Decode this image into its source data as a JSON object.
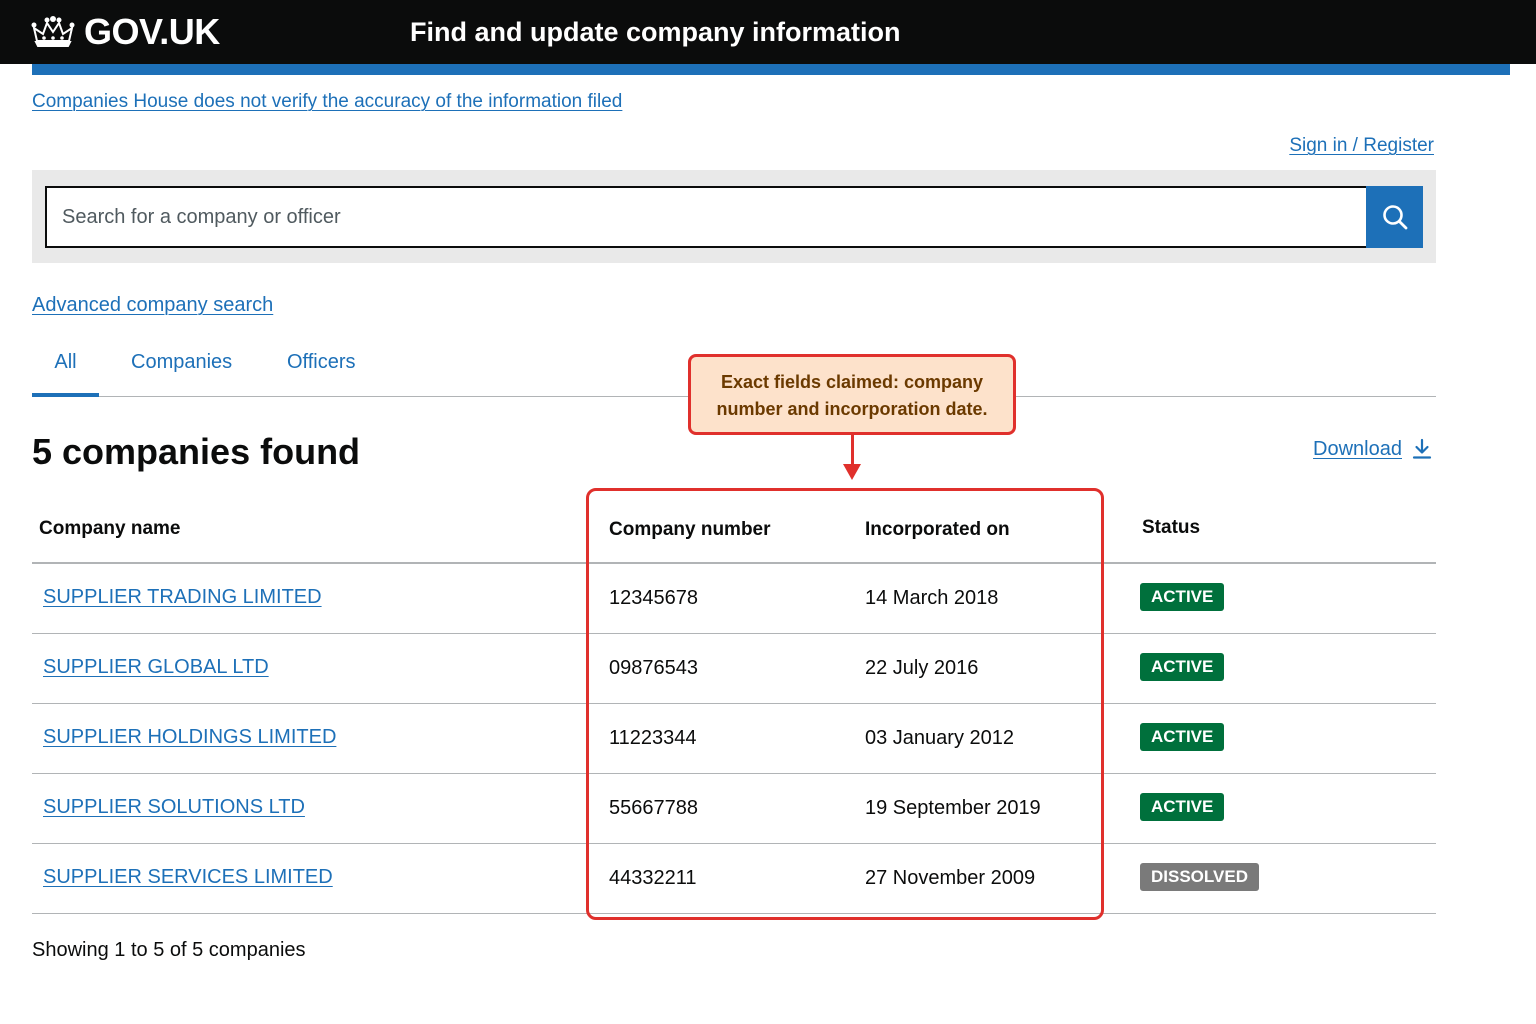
{
  "header": {
    "logo_text": "GOV.UK",
    "logo_icon": "crown-icon",
    "service_name": "Find and update company information"
  },
  "colors": {
    "header_bg": "#0b0c0c",
    "brand_blue": "#1d70b8",
    "active_green": "#00703c",
    "dissolved_grey": "#7a7a7a",
    "annotation_red": "#e0302c",
    "annotation_fill": "#fde2cb"
  },
  "disclaimer_link": "Companies House does not verify the accuracy of the information filed",
  "signin_link": "Sign in / Register",
  "search": {
    "placeholder": "Search for a company or officer",
    "value": "",
    "button_icon": "search-icon"
  },
  "advanced_search_link": "Advanced company search",
  "tabs": [
    {
      "label": "All",
      "active": true
    },
    {
      "label": "Companies",
      "active": false
    },
    {
      "label": "Officers",
      "active": false
    }
  ],
  "results": {
    "heading": "5 companies found",
    "download_label": "Download",
    "download_icon": "download-icon",
    "columns": [
      "Company name",
      "Company number",
      "Incorporated on",
      "Status"
    ],
    "rows": [
      {
        "name": "SUPPLIER TRADING LIMITED",
        "number": "12345678",
        "incorporated": "14 March 2018",
        "status": "ACTIVE"
      },
      {
        "name": "SUPPLIER GLOBAL LTD",
        "number": "09876543",
        "incorporated": "22 July 2016",
        "status": "ACTIVE"
      },
      {
        "name": "SUPPLIER HOLDINGS LIMITED",
        "number": "11223344",
        "incorporated": "03 January 2012",
        "status": "ACTIVE"
      },
      {
        "name": "SUPPLIER SOLUTIONS LTD",
        "number": "55667788",
        "incorporated": "19 September 2019",
        "status": "ACTIVE"
      },
      {
        "name": "SUPPLIER SERVICES LIMITED",
        "number": "44332211",
        "incorporated": "27 November 2009",
        "status": "DISSOLVED"
      }
    ],
    "showing_text": "Showing 1 to 5 of 5 companies"
  },
  "annotation": {
    "line1": "Exact fields claimed: company",
    "line2": "number and incorporation date."
  }
}
